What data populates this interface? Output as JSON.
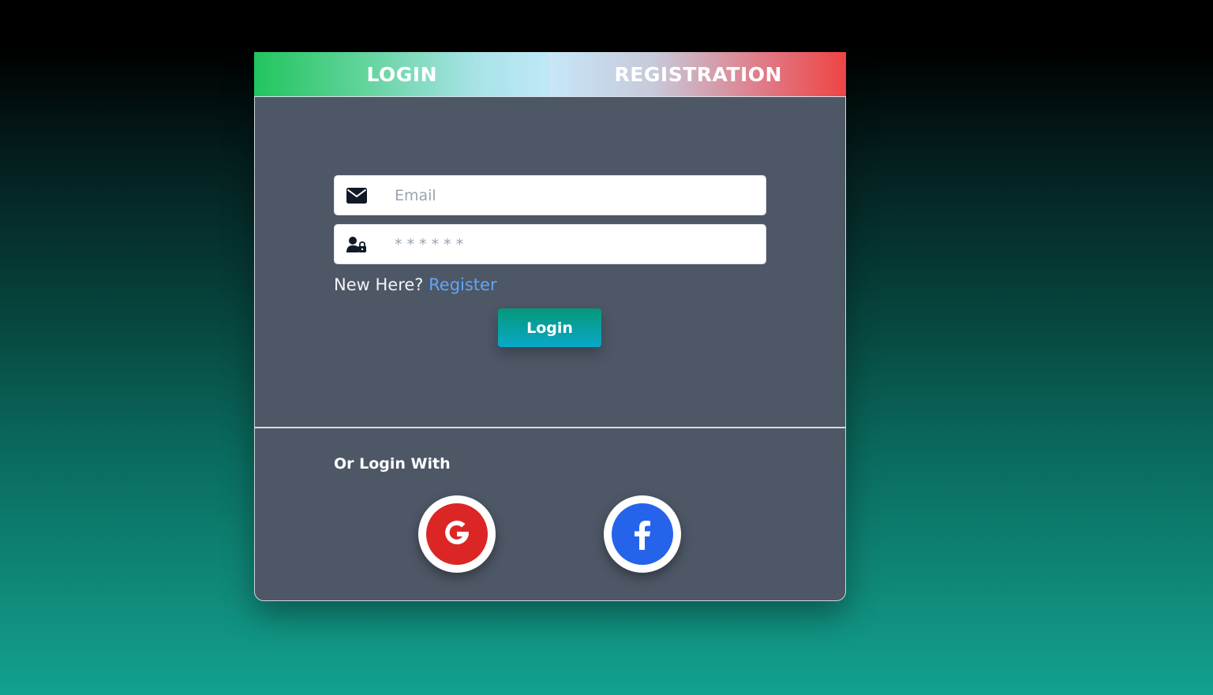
{
  "tabs": {
    "login_label": "LOGIN",
    "registration_label": "REGISTRATION"
  },
  "form": {
    "email_placeholder": "Email",
    "email_value": "",
    "password_placeholder": "* * * * * *",
    "password_value": "",
    "email_icon": "envelope-icon",
    "password_icon": "user-lock-icon"
  },
  "prompt": {
    "text": "New Here?",
    "register_link": "Register"
  },
  "login_button": "Login",
  "social": {
    "heading": "Or Login With",
    "google_icon": "google-icon",
    "facebook_icon": "facebook-icon"
  },
  "colors": {
    "login_tab_start": "#22c55e",
    "registration_tab_end": "#ef4444",
    "card_bg": "#4d5766",
    "link": "#60a5fa",
    "google": "#dc2626",
    "facebook": "#2563eb"
  }
}
